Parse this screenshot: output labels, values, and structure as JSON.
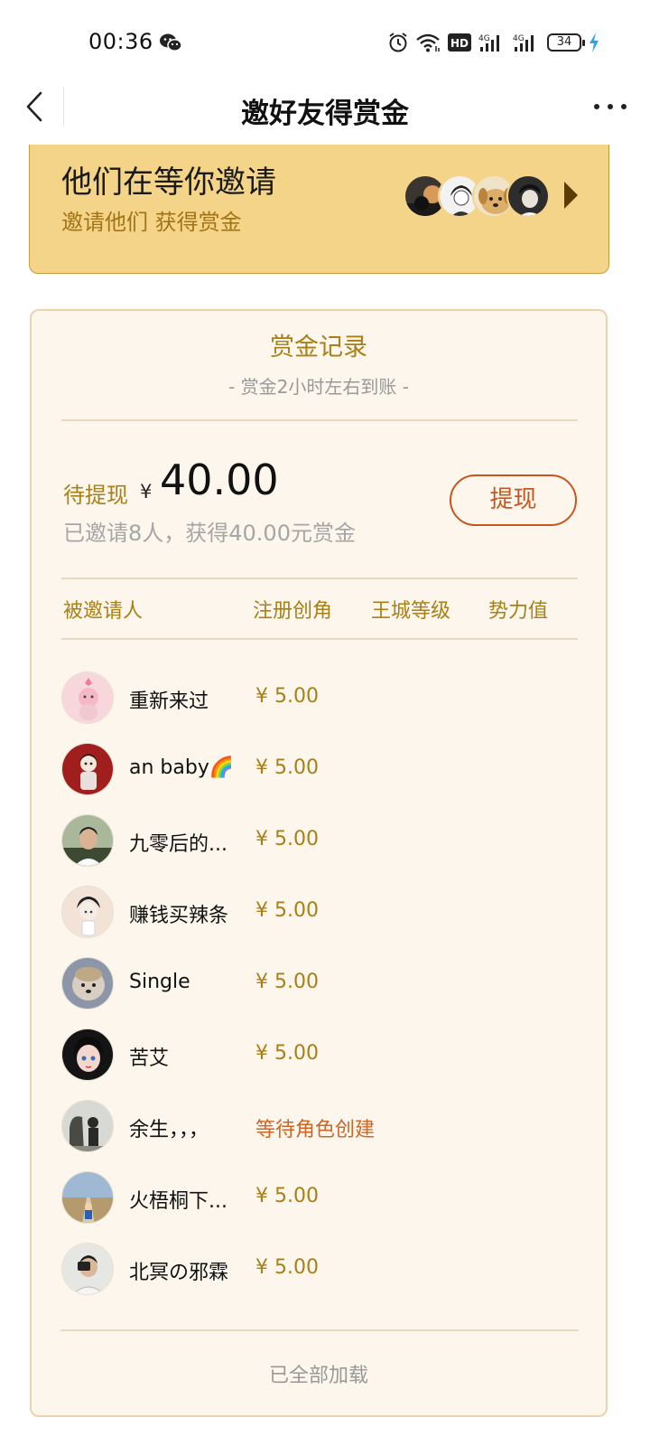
{
  "status_bar": {
    "time": "00:36",
    "battery": "34",
    "icons": [
      "wechat-icon",
      "alarm-icon",
      "wifi-icon",
      "hd-icon",
      "signal-4g-icon",
      "signal-4g-icon",
      "battery-icon",
      "charging-icon"
    ]
  },
  "nav": {
    "title": "邀好友得赏金",
    "back_icon": "chevron-left-icon",
    "more_icon": "more-dots-icon"
  },
  "invite_banner": {
    "title": "他们在等你邀请",
    "subtitle": "邀请他们 获得赏金"
  },
  "record": {
    "title": "赏金记录",
    "subtitle": "- 赏金2小时左右到账 -",
    "pending_label": "待提现",
    "currency": "¥",
    "pending_amount": "40.00",
    "summary": "已邀请8人，获得40.00元赏金",
    "withdraw_label": "提现",
    "columns": [
      "被邀请人",
      "注册创角",
      "王城等级",
      "势力值"
    ],
    "rows": [
      {
        "name": "重新来过",
        "reward": "¥ 5.00"
      },
      {
        "name": "an baby🌈",
        "reward": "¥ 5.00"
      },
      {
        "name": "九零后的...",
        "reward": "¥ 5.00"
      },
      {
        "name": "赚钱买辣条",
        "reward": "¥ 5.00"
      },
      {
        "name": "Single",
        "reward": "¥ 5.00"
      },
      {
        "name": "苦艾",
        "reward": "¥ 5.00"
      },
      {
        "name": "余生，，，",
        "reward": "等待角色创建"
      },
      {
        "name": "火梧桐下...",
        "reward": "¥ 5.00"
      },
      {
        "name": "北冥の邪霖",
        "reward": "¥ 5.00"
      }
    ],
    "footer": "已全部加载"
  },
  "colors": {
    "banner_bg": "#f3d488",
    "gold_text": "#a98018",
    "accent_orange": "#c8551f",
    "card_bg": "#fcf6ec"
  }
}
